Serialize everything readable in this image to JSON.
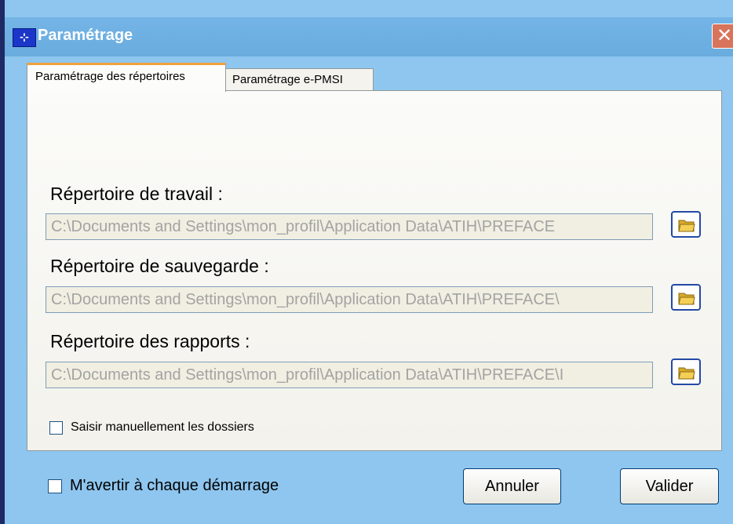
{
  "window": {
    "title": "Paramétrage",
    "close_glyph": "✕",
    "icon_glyph": "⊹"
  },
  "tabs": [
    {
      "label": "Paramétrage des répertoires",
      "active": true
    },
    {
      "label": "Paramétrage e-PMSI",
      "active": false
    }
  ],
  "directories": [
    {
      "label": "Répertoire de travail :",
      "value": "C:\\Documents and Settings\\mon_profil\\Application Data\\ATIH\\PREFACE"
    },
    {
      "label": "Répertoire de sauvegarde :",
      "value": "C:\\Documents and Settings\\mon_profil\\Application Data\\ATIH\\PREFACE\\"
    },
    {
      "label": "Répertoire des rapports :",
      "value": "C:\\Documents and Settings\\mon_profil\\Application Data\\ATIH\\PREFACE\\I"
    }
  ],
  "manual_checkbox": {
    "label": "Saisir manuellement les dossiers",
    "checked": false
  },
  "startup_checkbox": {
    "label": "M'avertir à chaque démarrage",
    "checked": false
  },
  "buttons": {
    "cancel": "Annuler",
    "ok": "Valider"
  },
  "icons": {
    "browse": "folder-icon"
  },
  "colors": {
    "titlebar": "#74b4e6",
    "window_bg": "#8ec6ef",
    "tab_accent": "#f0a23c"
  }
}
